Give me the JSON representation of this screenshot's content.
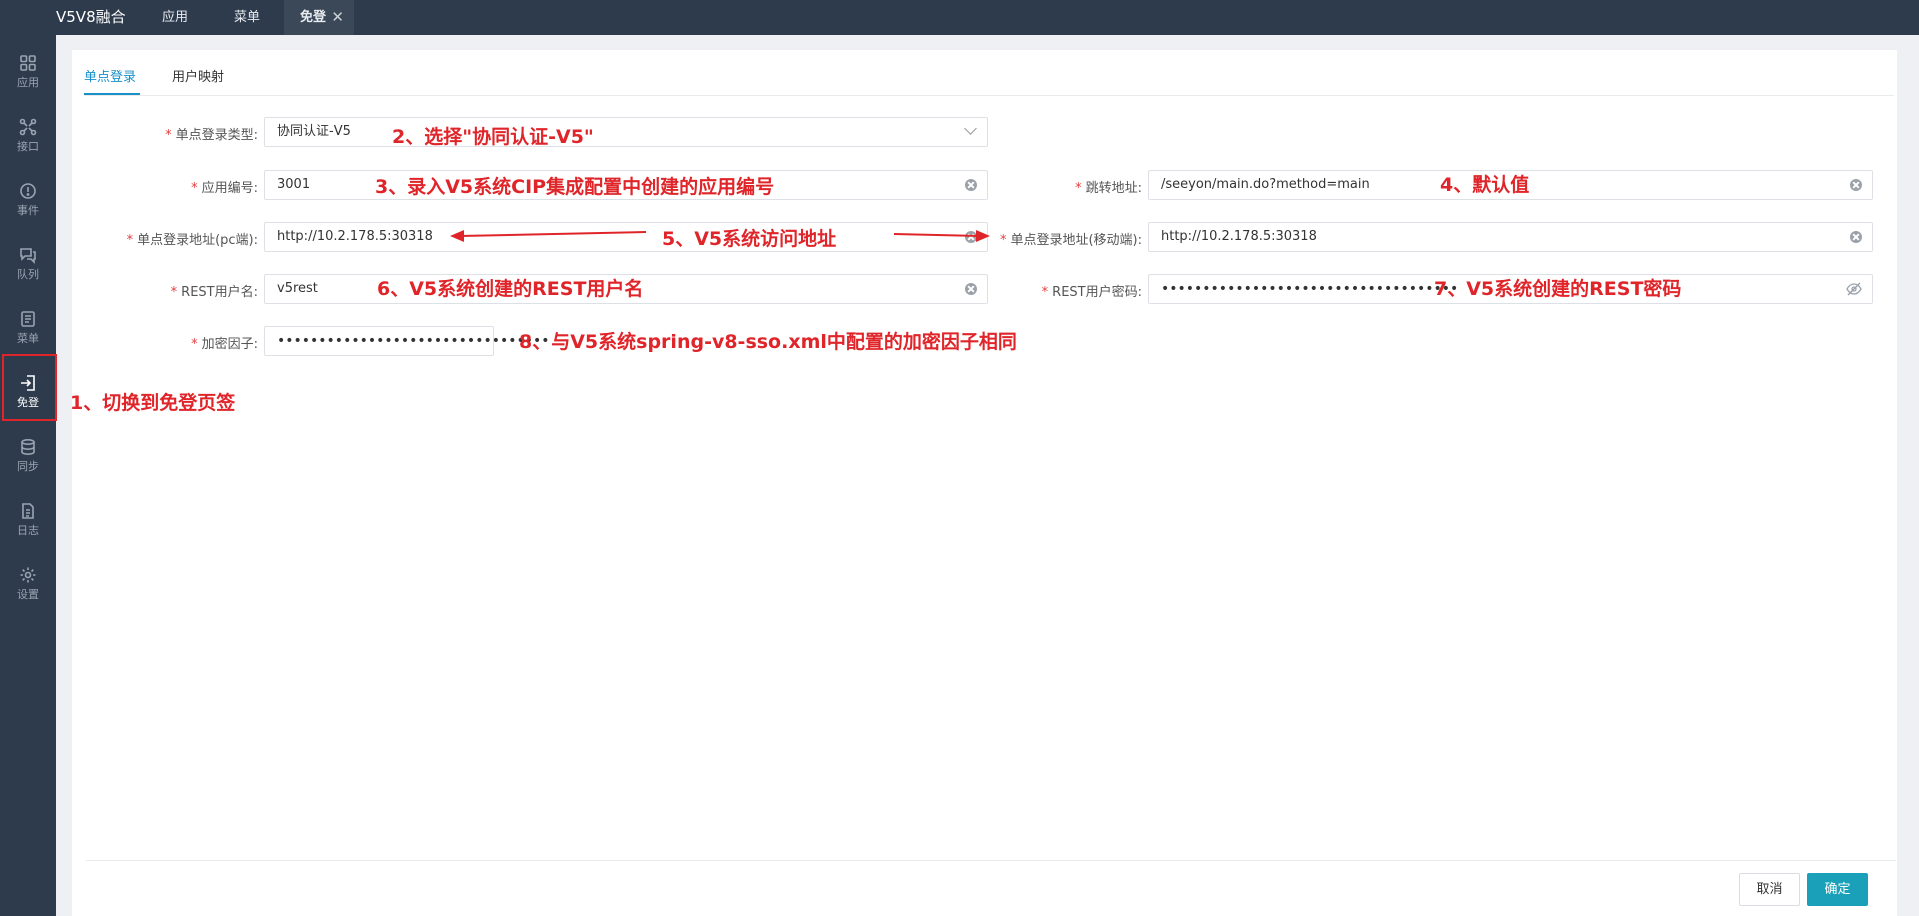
{
  "topbar": {
    "app_title": "V5V8融合",
    "tabs": [
      {
        "label": "应用"
      },
      {
        "label": "菜单"
      },
      {
        "label": "免登",
        "active": true
      }
    ]
  },
  "sidebar": {
    "items": [
      {
        "label": "应用",
        "icon": "grid-icon"
      },
      {
        "label": "接口",
        "icon": "interface-icon"
      },
      {
        "label": "事件",
        "icon": "alert-icon"
      },
      {
        "label": "队列",
        "icon": "queue-icon"
      },
      {
        "label": "菜单",
        "icon": "menu-doc-icon"
      },
      {
        "label": "免登",
        "icon": "login-icon",
        "active": true
      },
      {
        "label": "同步",
        "icon": "database-icon"
      },
      {
        "label": "日志",
        "icon": "log-icon"
      },
      {
        "label": "设置",
        "icon": "gear-icon"
      }
    ]
  },
  "tabs": {
    "sso": "单点登录",
    "user_mapping": "用户映射"
  },
  "form": {
    "sso_type": {
      "label": "单点登录类型:",
      "value": "协同认证-V5"
    },
    "app_code": {
      "label": "应用编号:",
      "value": "3001"
    },
    "redirect_url": {
      "label": "跳转地址:",
      "value": "/seeyon/main.do?method=main"
    },
    "sso_pc_url": {
      "label": "单点登录地址(pc端):",
      "value": "http://10.2.178.5:30318"
    },
    "sso_mobile_url": {
      "label": "单点登录地址(移动端):",
      "value": "http://10.2.178.5:30318"
    },
    "rest_user": {
      "label": "REST用户名:",
      "value": "v5rest"
    },
    "rest_password": {
      "label": "REST用户密码:",
      "value": "••••••••••••••••••••••••••••••••••••"
    },
    "encrypt_factor": {
      "label": "加密因子:",
      "value": "•••••••••••••••••••••••••••••••••"
    }
  },
  "annotations": {
    "a1": "1、切换到免登页签",
    "a2": "2、选择\"协同认证-V5\"",
    "a3": "3、录入V5系统CIP集成配置中创建的应用编号",
    "a4": "4、默认值",
    "a5": "5、V5系统访问地址",
    "a6": "6、V5系统创建的REST用户名",
    "a7": "7、V5系统创建的REST密码",
    "a8": "8、与V5系统spring-v8-sso.xml中配置的加密因子相同"
  },
  "footer": {
    "cancel": "取消",
    "ok": "确定"
  },
  "colors": {
    "sidebar_bg": "#2e3b4c",
    "accent": "#1890c8",
    "ok_button": "#1aa0b8",
    "annotation": "#e0252a"
  }
}
